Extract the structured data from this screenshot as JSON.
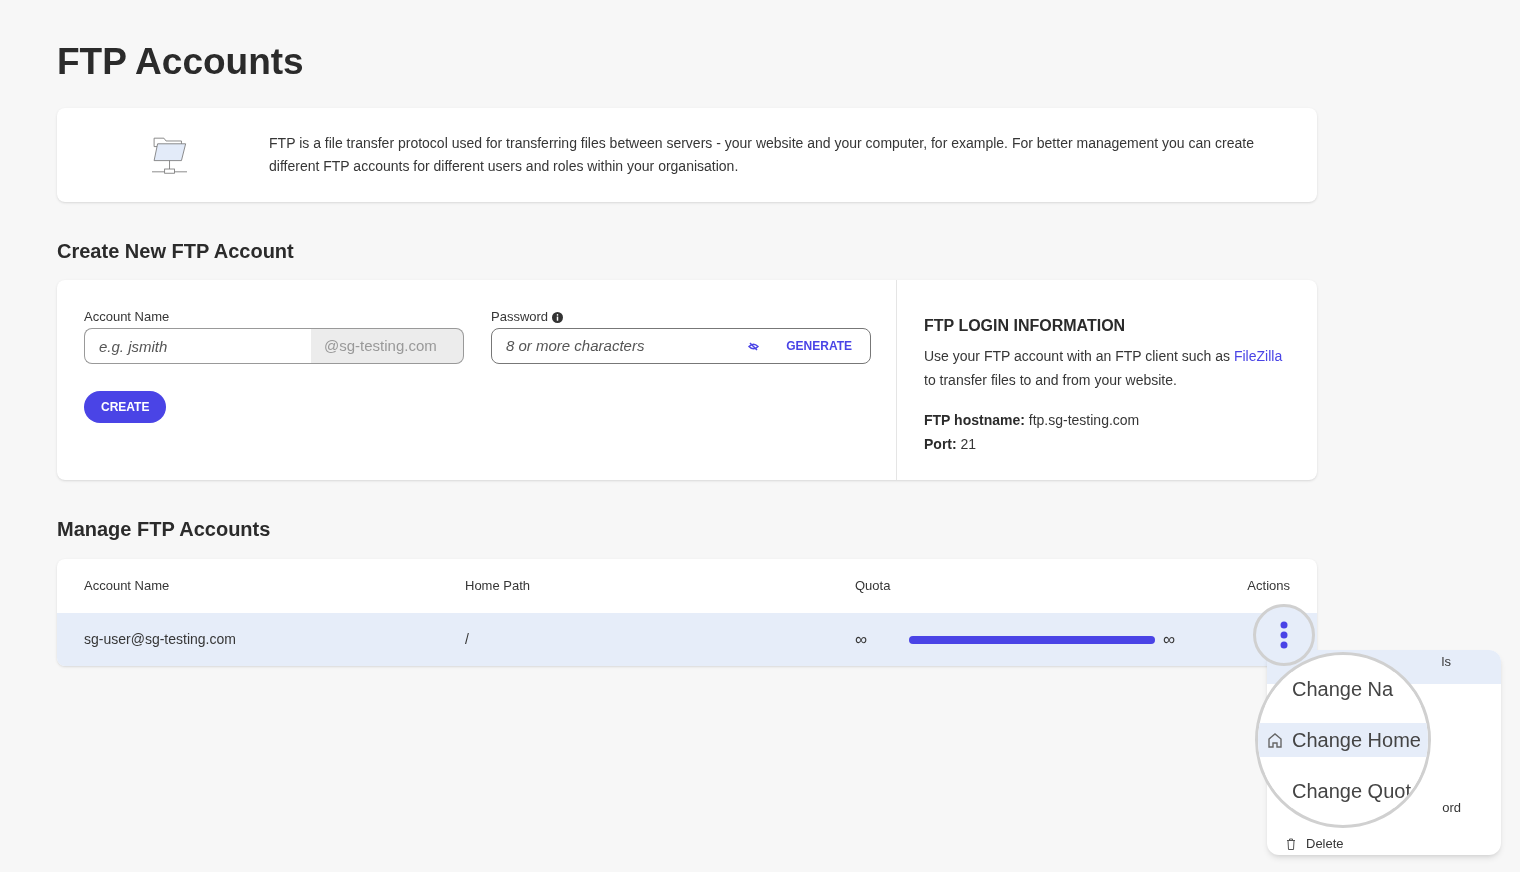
{
  "title": "FTP Accounts",
  "intro": "FTP is a file transfer protocol used for transferring files between servers - your website and your computer, for example. For better management you can create different FTP accounts for different users and roles within your organisation.",
  "create": {
    "heading": "Create New FTP Account",
    "account_name": {
      "label": "Account Name",
      "placeholder": "e.g. jsmith",
      "suffix": "@sg-testing.com"
    },
    "password": {
      "label": "Password",
      "placeholder": "8 or more characters",
      "generate": "GENERATE"
    },
    "button": "CREATE"
  },
  "login_info": {
    "heading": "FTP LOGIN INFORMATION",
    "text": "Use your FTP account with an FTP client such as",
    "link": "FileZilla",
    "text_after": "to transfer files to and from your website.",
    "details": [
      {
        "label": "FTP hostname:",
        "value": "ftp.sg-testing.com"
      },
      {
        "label": "Port:",
        "value": "21"
      }
    ]
  },
  "manage": {
    "heading": "Manage FTP Accounts",
    "columns": [
      "Account Name",
      "Home Path",
      "Quota",
      "Actions"
    ],
    "rows": [
      {
        "account": "sg-user@sg-testing.com",
        "path": "/",
        "quota_used": "∞",
        "quota_total": "∞",
        "level": 1,
        "selected": true
      }
    ]
  },
  "menu": {
    "items": [
      {
        "label": "ls",
        "selected": true,
        "kind": "plain"
      },
      {
        "label": "ord",
        "selected": false,
        "kind": "plain"
      },
      {
        "label": "Delete",
        "selected": false,
        "kind": "delete"
      }
    ]
  },
  "magnifier": {
    "lines": [
      {
        "label": "Change Na",
        "selected": false,
        "kind": "plain"
      },
      {
        "label": "Change Home",
        "selected": true,
        "kind": "home"
      },
      {
        "label": "Change Quot",
        "selected": false,
        "kind": "plain"
      }
    ]
  }
}
